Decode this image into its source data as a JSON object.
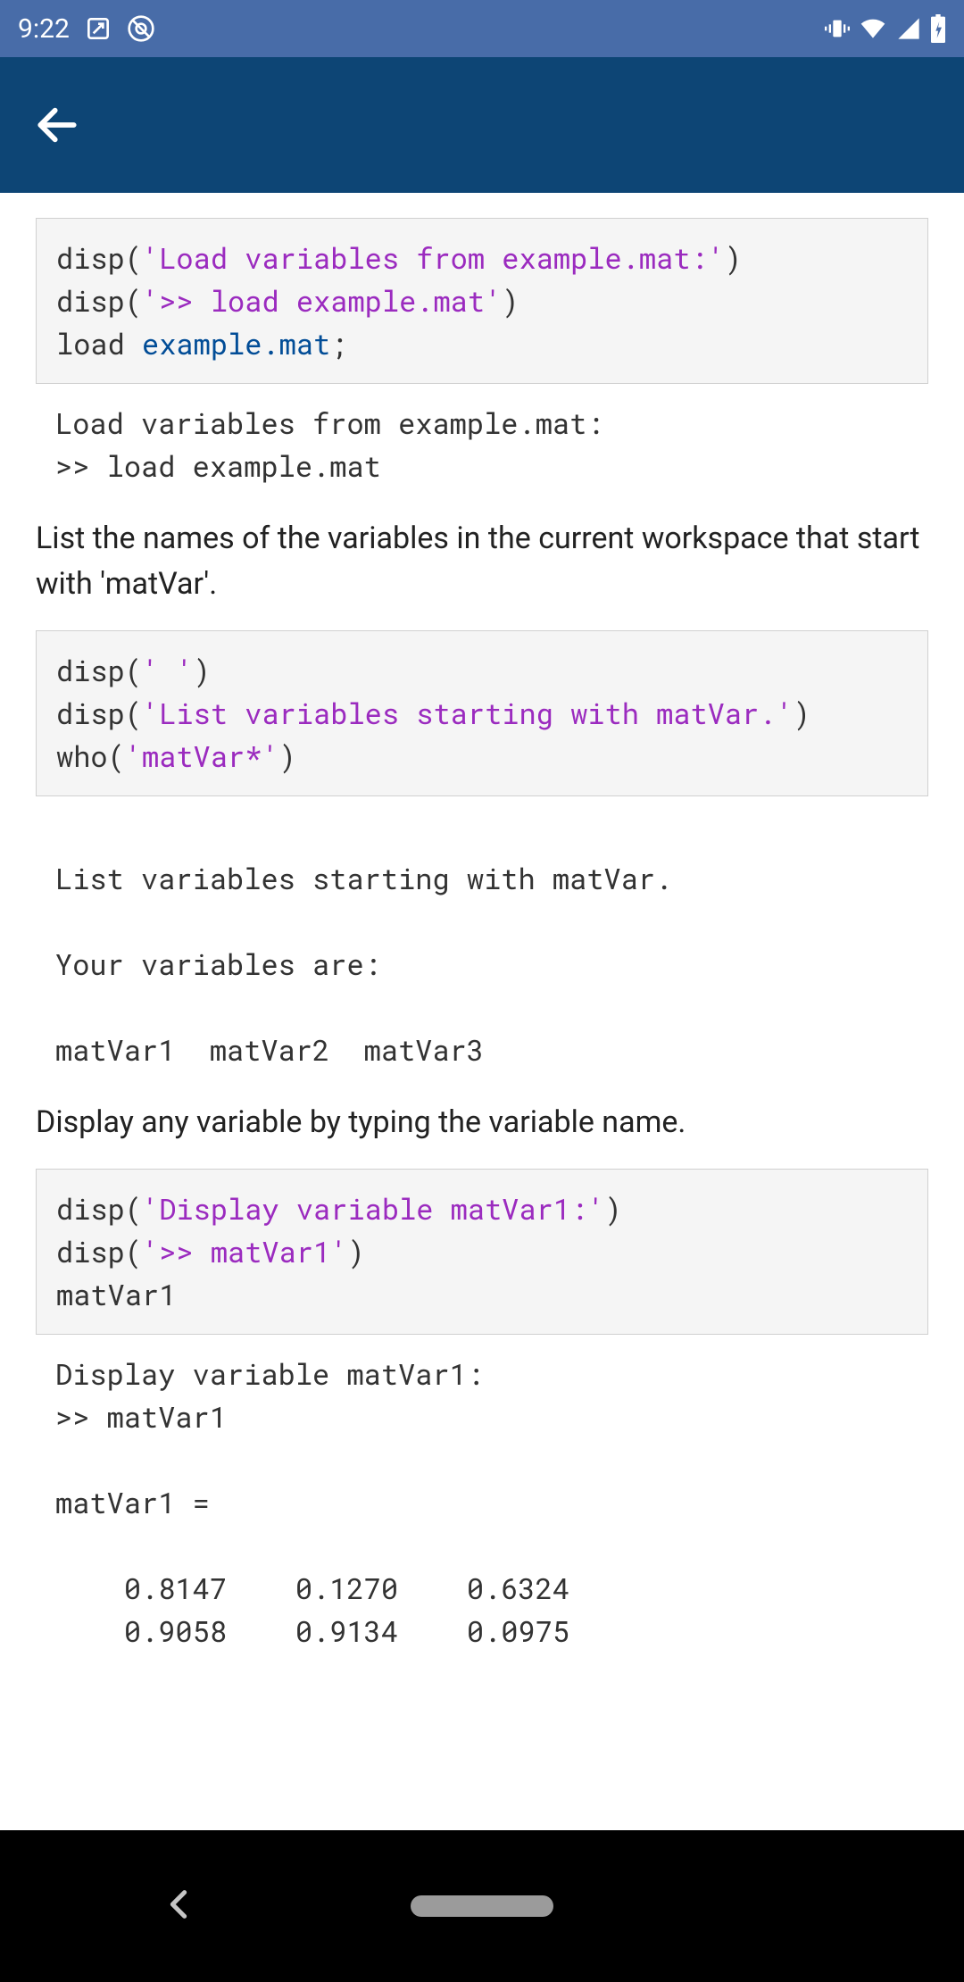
{
  "status": {
    "time": "9:22"
  },
  "code1": {
    "l1a": "disp(",
    "l1b": "'Load variables from example.mat:'",
    "l1c": ")",
    "l2a": "disp(",
    "l2b": "'>> load example.mat'",
    "l2c": ")",
    "l3a": "load ",
    "l3b": "example.mat",
    "l3c": ";"
  },
  "out1": "Load variables from example.mat:\n>> load example.mat",
  "para1": "List the names of the variables in the current workspace that start with 'matVar'.",
  "code2": {
    "l1a": "disp(",
    "l1b": "' '",
    "l1c": ")",
    "l2a": "disp(",
    "l2b": "'List variables starting with matVar.'",
    "l2c": ")",
    "l3a": "who(",
    "l3b": "'matVar*'",
    "l3c": ")"
  },
  "out2": " \nList variables starting with matVar.\n\nYour variables are:\n\nmatVar1  matVar2  matVar3  ",
  "para2": "Display any variable by typing the variable name.",
  "code3": {
    "l1a": "disp(",
    "l1b": "'Display variable matVar1:'",
    "l1c": ")",
    "l2a": "disp(",
    "l2b": "'>> matVar1'",
    "l2c": ")",
    "l3": "matVar1"
  },
  "out3": "Display variable matVar1:\n>> matVar1\n\nmatVar1 =\n\n    0.8147    0.1270    0.6324\n    0.9058    0.9134    0.0975"
}
